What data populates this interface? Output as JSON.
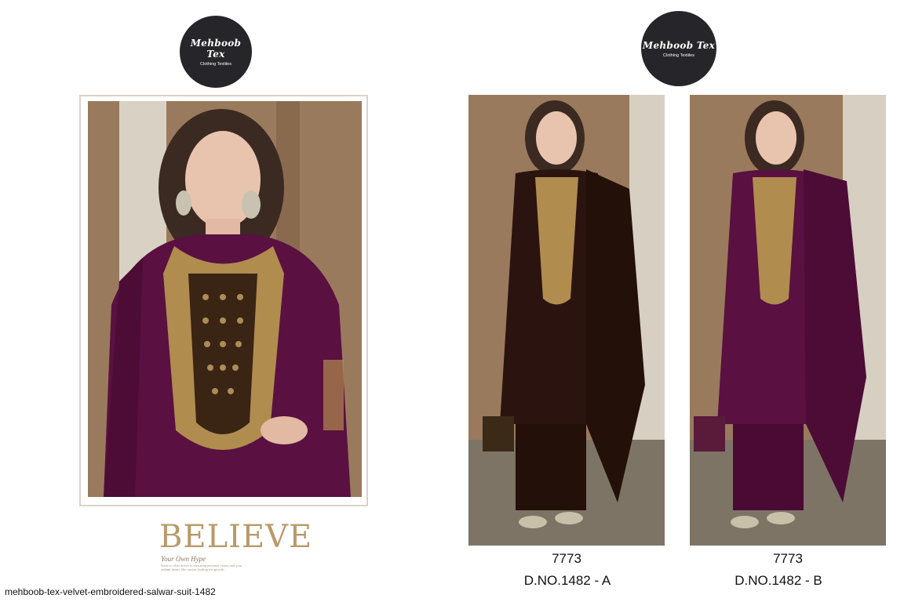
{
  "logos": {
    "brand": "Mehboob Tex",
    "subtitle": "Clothing Textiles"
  },
  "images": {
    "main": "model in purple velvet embroidered suit (close-up)",
    "variant_a": "model in brown velvet embroidered suit",
    "variant_b": "model in purple velvet embroidered suit"
  },
  "promo": {
    "headline": "BELIEVE",
    "tagline": "Your Own Hype",
    "fine_print": "Stick to what drives to elevating personal vision and your radiant hearts like canvas leading the growth."
  },
  "designs": [
    {
      "code": "7773",
      "label": "D.NO.1482 - A"
    },
    {
      "code": "7773",
      "label": "D.NO.1482 - B"
    }
  ],
  "caption": "mehboob-tex-velvet-embroidered-salwar-suit-1482",
  "colors": {
    "logo_bg": "#26262a",
    "purple": "#5a1040",
    "brown": "#2b1410",
    "gold": "#b08c4e",
    "wall": "#9a7a5c"
  }
}
